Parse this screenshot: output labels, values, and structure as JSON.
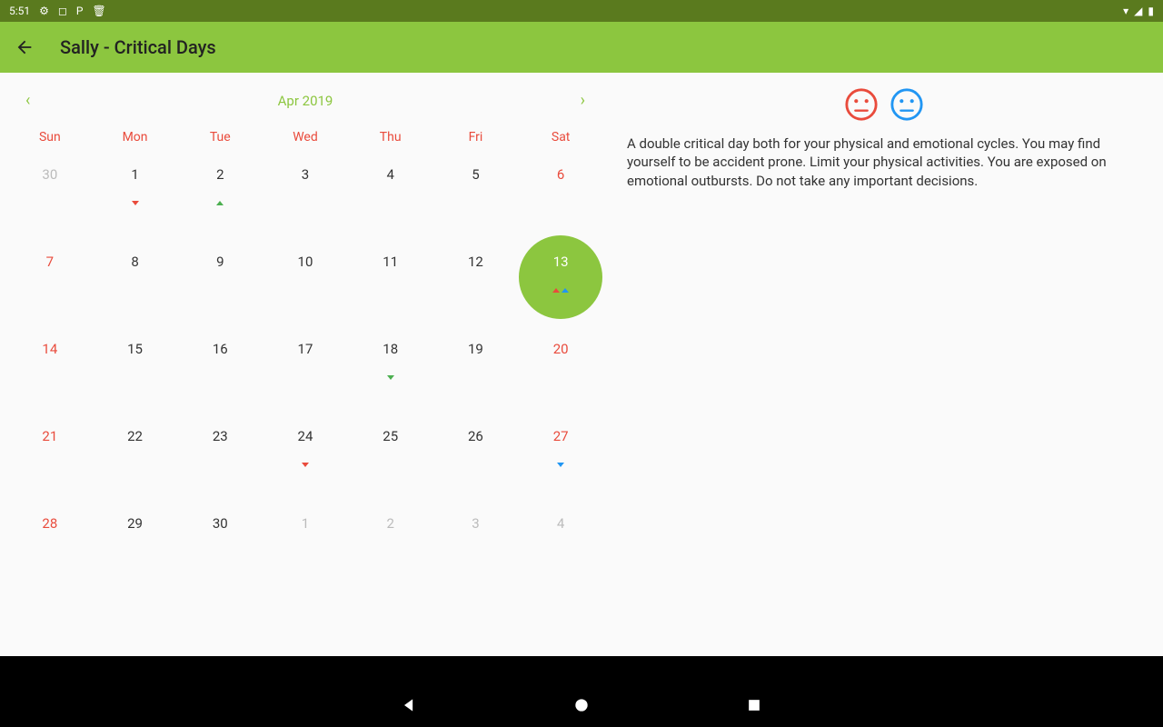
{
  "statusbar": {
    "time": "5:51"
  },
  "appbar": {
    "title": "Sally - Critical Days"
  },
  "calendar": {
    "month_label": "Apr 2019",
    "dow": [
      "Sun",
      "Mon",
      "Tue",
      "Wed",
      "Thu",
      "Fri",
      "Sat"
    ],
    "cells": [
      {
        "n": "30",
        "outside": true
      },
      {
        "n": "1",
        "marks": [
          "down-red"
        ]
      },
      {
        "n": "2",
        "marks": [
          "up-green"
        ]
      },
      {
        "n": "3"
      },
      {
        "n": "4"
      },
      {
        "n": "5"
      },
      {
        "n": "6",
        "weekend": true
      },
      {
        "n": "7",
        "weekend": true
      },
      {
        "n": "8"
      },
      {
        "n": "9"
      },
      {
        "n": "10"
      },
      {
        "n": "11"
      },
      {
        "n": "12"
      },
      {
        "n": "13",
        "selected": true,
        "marks": [
          "up-red",
          "up-blue"
        ]
      },
      {
        "n": "14",
        "weekend": true
      },
      {
        "n": "15"
      },
      {
        "n": "16"
      },
      {
        "n": "17"
      },
      {
        "n": "18",
        "marks": [
          "down-green"
        ]
      },
      {
        "n": "19"
      },
      {
        "n": "20",
        "weekend": true
      },
      {
        "n": "21",
        "weekend": true
      },
      {
        "n": "22"
      },
      {
        "n": "23"
      },
      {
        "n": "24",
        "marks": [
          "down-red"
        ]
      },
      {
        "n": "25"
      },
      {
        "n": "26"
      },
      {
        "n": "27",
        "weekend": true,
        "marks": [
          "down-blue"
        ]
      },
      {
        "n": "28",
        "weekend": true
      },
      {
        "n": "29"
      },
      {
        "n": "30"
      },
      {
        "n": "1",
        "outside": true
      },
      {
        "n": "2",
        "outside": true
      },
      {
        "n": "3",
        "outside": true
      },
      {
        "n": "4",
        "outside": true
      }
    ]
  },
  "detail": {
    "faces": [
      "red",
      "blue"
    ],
    "text": "A double critical day both for your physical and emotional cycles. You may find yourself to be accident prone. Limit your physical activities. You are exposed on emotional outbursts. Do not take any important decisions."
  }
}
